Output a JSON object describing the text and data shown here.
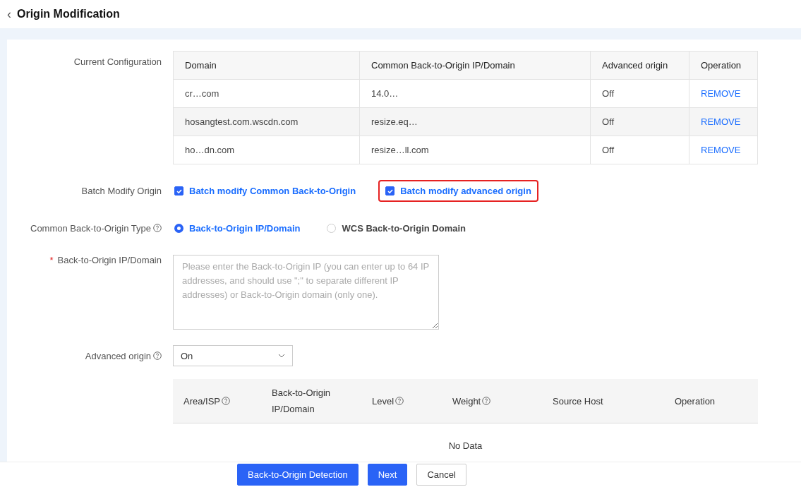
{
  "header": {
    "back_icon": "‹",
    "title": "Origin Modification"
  },
  "current_configuration": {
    "label": "Current Configuration",
    "columns": [
      "Domain",
      "Common Back-to-Origin IP/Domain",
      "Advanced origin",
      "Operation"
    ],
    "rows": [
      {
        "domain": "cr…com",
        "origin": "14.0…",
        "advanced": "Off",
        "action": "REMOVE"
      },
      {
        "domain": "hosangtest.com.wscdn.com",
        "origin": "resize.eq…",
        "advanced": "Off",
        "action": "REMOVE"
      },
      {
        "domain": "ho…dn.com",
        "origin": "resize…ll.com",
        "advanced": "Off",
        "action": "REMOVE"
      }
    ]
  },
  "batch_modify": {
    "label": "Batch Modify Origin",
    "options": [
      {
        "label": "Batch modify Common Back-to-Origin",
        "checked": true,
        "highlighted": false
      },
      {
        "label": "Batch modify advanced origin",
        "checked": true,
        "highlighted": true
      }
    ]
  },
  "origin_type": {
    "label": "Common Back-to-Origin Type",
    "options": [
      {
        "label": "Back-to-Origin IP/Domain",
        "selected": true
      },
      {
        "label": "WCS Back-to-Origin Domain",
        "selected": false
      }
    ]
  },
  "origin_input": {
    "required_mark": "*",
    "label": "Back-to-Origin IP/Domain",
    "placeholder": "Please enter the Back-to-Origin IP (you can enter up to 64 IP addresses, and should use \";\" to separate different IP addresses) or Back-to-Origin domain (only one)."
  },
  "advanced_origin": {
    "label": "Advanced origin",
    "value": "On",
    "columns": [
      {
        "label": "Area/ISP",
        "help": true
      },
      {
        "label": "Back-to-Origin IP/Domain",
        "help": false
      },
      {
        "label": "Level",
        "help": true
      },
      {
        "label": "Weight",
        "help": true
      },
      {
        "label": "Source Host",
        "help": false
      },
      {
        "label": "Operation",
        "help": false
      }
    ],
    "empty": "No Data"
  },
  "buttons": [
    {
      "label": "Back-to-Origin Detection",
      "primary": true
    },
    {
      "label": "Next",
      "primary": true
    },
    {
      "label": "Cancel",
      "primary": false
    }
  ]
}
